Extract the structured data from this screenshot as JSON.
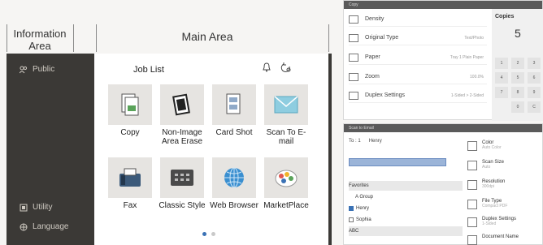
{
  "labels": {
    "information_area": "Information Area",
    "main_area": "Main Area"
  },
  "sidebar": {
    "top_item": "Public",
    "bottom_items": [
      "Utility",
      "Language"
    ]
  },
  "main": {
    "job_list": "Job List",
    "apps": [
      {
        "label": "Copy",
        "icon": "copy-icon"
      },
      {
        "label": "Non-Image Area Erase",
        "icon": "non-image-erase-icon"
      },
      {
        "label": "Card Shot",
        "icon": "card-shot-icon"
      },
      {
        "label": "Scan To E-mail",
        "icon": "email-icon"
      },
      {
        "label": "Fax",
        "icon": "fax-icon"
      },
      {
        "label": "Classic Style",
        "icon": "classic-style-icon"
      },
      {
        "label": "Web Browser",
        "icon": "globe-icon"
      },
      {
        "label": "MarketPlace",
        "icon": "marketplace-icon"
      }
    ],
    "page_dots": {
      "count": 2,
      "active": 0
    }
  },
  "copy_screen": {
    "title": "Copy",
    "rows": [
      {
        "label": "Density",
        "value": ""
      },
      {
        "label": "Original Type",
        "value": "Text/Photo"
      },
      {
        "label": "Paper",
        "value": "Tray 1 Plain Paper"
      },
      {
        "label": "Zoom",
        "value": "100.0%"
      },
      {
        "label": "Duplex Settings",
        "value": "1-Sided > 2-Sided"
      }
    ],
    "copies_label": "Copies",
    "copies_value": "5",
    "keypad": [
      "1",
      "2",
      "3",
      "4",
      "5",
      "6",
      "7",
      "8",
      "9",
      "",
      "0",
      "C"
    ]
  },
  "scan_screen": {
    "title": "Scan to Email",
    "to_label": "To : 1",
    "to_name": "Henry",
    "tabs": "Favorites",
    "list": [
      {
        "label": "Favorites",
        "header": true
      },
      {
        "label": "A Group",
        "header": false
      },
      {
        "label": "Henry",
        "header": false,
        "checked": true
      },
      {
        "label": "Sophia",
        "header": false,
        "checked": false
      },
      {
        "label": "ABC",
        "header": true
      }
    ],
    "settings": [
      {
        "label": "Color",
        "value": "Auto Color"
      },
      {
        "label": "Scan Size",
        "value": "Auto"
      },
      {
        "label": "Resolution",
        "value": "300dpi"
      },
      {
        "label": "File Type",
        "value": "Compact PDF"
      },
      {
        "label": "Duplex Settings",
        "value": "1-Sided"
      },
      {
        "label": "Document Name",
        "value": ""
      }
    ]
  },
  "colors": {
    "sidebar_bg": "#3b39 36",
    "accent": "#3b72b5",
    "tile_bg": "#e6e4e1"
  }
}
